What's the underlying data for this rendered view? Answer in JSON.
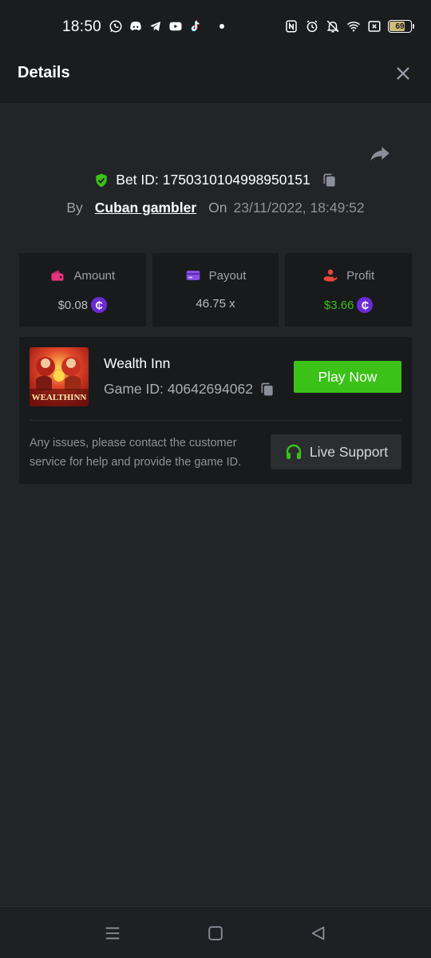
{
  "status_bar": {
    "time": "18:50",
    "left_icons": [
      "whatsapp-icon",
      "discord-icon",
      "telegram-icon",
      "youtube-icon",
      "tiktok-icon",
      "dot-icon"
    ],
    "right_icons": [
      "nfc-icon",
      "alarm-icon",
      "bell-off-icon",
      "wifi-icon",
      "close-box-icon",
      "battery-icon"
    ],
    "battery_level": "69"
  },
  "header": {
    "title": "Details"
  },
  "bet": {
    "id_label": "Bet ID:",
    "id_value": "1750310104998950151",
    "by_label": "By",
    "user": "Cuban gambler",
    "on_label": "On",
    "date": "23/11/2022, 18:49:52"
  },
  "stats": {
    "amount": {
      "label": "Amount",
      "value": "$0.08",
      "icon": "wallet-icon"
    },
    "payout": {
      "label": "Payout",
      "value": "46.75 x",
      "icon": "card-icon"
    },
    "profit": {
      "label": "Profit",
      "value": "$3.66",
      "icon": "hand-coin-icon"
    },
    "coin_symbol": "₵"
  },
  "game": {
    "name": "Wealth Inn",
    "id_label": "Game ID:",
    "id_value": "40642694062",
    "thumb_text": "WEALTHINN",
    "play_label": "Play Now",
    "support_text": "Any issues, please contact the customer service for help and provide the game ID.",
    "support_label": "Live Support"
  },
  "colors": {
    "accent_green": "#3bc117",
    "coin_purple": "#6b2bd6",
    "amount_pink": "#e4357a",
    "payout_purple": "#8b4fe8",
    "profit_red": "#e8453c"
  },
  "nav": {
    "buttons": [
      "menu-icon",
      "home-icon",
      "back-icon"
    ]
  }
}
